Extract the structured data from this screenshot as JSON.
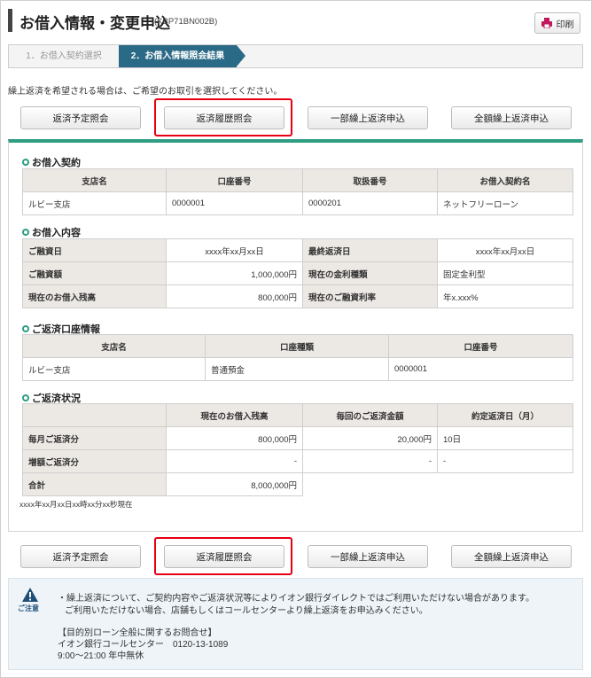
{
  "header": {
    "title": "お借入情報・変更申込",
    "code": "(KBP71BN002B)",
    "print_label": "印刷"
  },
  "steps": [
    {
      "label": "1．お借入契約選択",
      "active": false
    },
    {
      "label": "2．お借入情報照会結果",
      "active": true
    }
  ],
  "intro_text": "繰上返済を希望される場合は、ご希望のお取引を選択してください。",
  "actions": {
    "schedule": "返済予定照会",
    "history": "返済履歴照会",
    "partial": "一部繰上返済申込",
    "full": "全額繰上返済申込"
  },
  "loan_contract": {
    "title": "お借入契約",
    "headers": [
      "支店名",
      "口座番号",
      "取扱番号",
      "お借入契約名"
    ],
    "row": [
      "ルビー支店",
      "0000001",
      "0000201",
      "ネットフリーローン"
    ]
  },
  "loan_details": {
    "title": "お借入内容",
    "rows": [
      [
        "ご融資日",
        "xxxx年xx月xx日",
        "最終返済日",
        "xxxx年xx月xx日"
      ],
      [
        "ご融資額",
        "1,000,000円",
        "現在の金利種類",
        "固定金利型"
      ],
      [
        "現在のお借入残高",
        "800,000円",
        "現在のご融資利率",
        "年x.xxx%"
      ]
    ]
  },
  "repay_account": {
    "title": "ご返済口座情報",
    "headers": [
      "支店名",
      "口座種類",
      "口座番号"
    ],
    "row": [
      "ルビー支店",
      "普通預金",
      "0000001"
    ]
  },
  "repay_status": {
    "title": "ご返済状況",
    "headers": [
      "現在のお借入残高",
      "毎回のご返済金額",
      "約定返済日（月）"
    ],
    "rows": [
      [
        "毎月ご返済分",
        "800,000円",
        "20,000円",
        "10日"
      ],
      [
        "増額ご返済分",
        "-",
        "-",
        "-"
      ]
    ],
    "total_label": "合計",
    "total_value": "8,000,000円",
    "as_of": "xxxx年xx月xx日xx時xx分xx秒現在"
  },
  "notice": {
    "label": "ご注意",
    "line1": "・繰上返済について、ご契約内容やご返済状況等によりイオン銀行ダイレクトではご利用いただけない場合があります。",
    "line2": "ご利用いただけない場合、店舗もしくはコールセンターより繰上返済をお申込みください。",
    "line3": "【目的別ローン全般に関するお問合せ】",
    "line4": "イオン銀行コールセンター　0120-13-1089",
    "line5": "9:00～21:00  年中無休"
  },
  "colors": {
    "accent": "#2e9e83",
    "step_active": "#2b6a87",
    "highlight": "#e60012",
    "header_cell": "#ece8e4",
    "notice_bg": "#eef4f8"
  }
}
